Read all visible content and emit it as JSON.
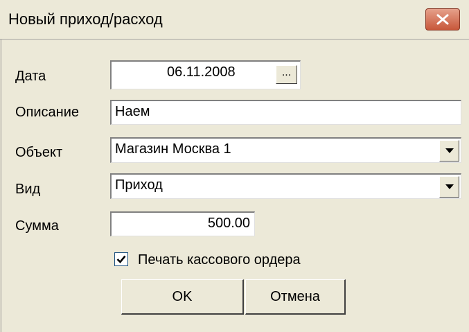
{
  "window": {
    "title": "Новый приход/расход"
  },
  "form": {
    "date": {
      "label": "Дата",
      "value": "06.11.2008",
      "button_label": "..."
    },
    "description": {
      "label": "Описание",
      "value": "Наем"
    },
    "object": {
      "label": "Объект",
      "value": "Магазин Москва 1"
    },
    "kind": {
      "label": "Вид",
      "value": "Приход"
    },
    "amount": {
      "label": "Сумма",
      "value": "500.00"
    },
    "print_order": {
      "label": "Печать кассового ордера",
      "checked": true
    }
  },
  "buttons": {
    "ok": "OK",
    "cancel": "Отмена"
  },
  "colors": {
    "close_button": "#c8573a",
    "window_bg": "#ece9d8"
  },
  "icons": {
    "close": "close-x-icon",
    "dropdown": "chevron-down-icon",
    "check": "checkmark-icon"
  }
}
